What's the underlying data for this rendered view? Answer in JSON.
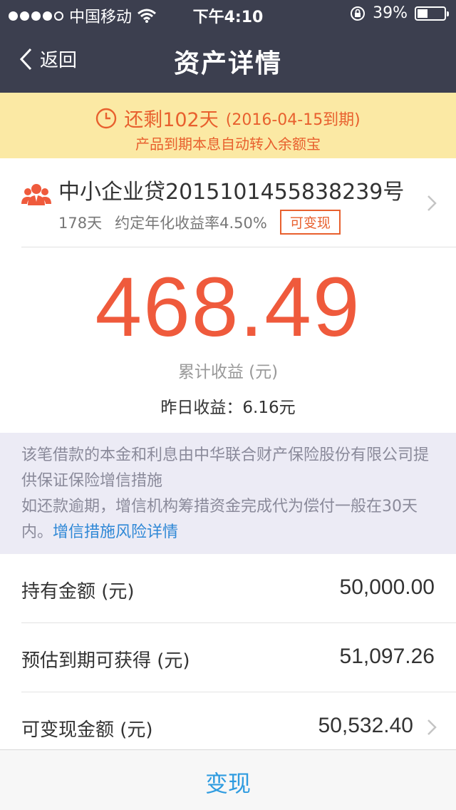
{
  "status_bar": {
    "carrier": "中国移动",
    "time": "下午4:10",
    "battery": "39%"
  },
  "nav": {
    "back_label": "返回",
    "title": "资产详情"
  },
  "notice": {
    "remaining": "还剩102天",
    "due": "(2016-04-15到期)",
    "message": "产品到期本息自动转入余额宝"
  },
  "product": {
    "name": "中小企业贷2015101455838239号",
    "term": "178天",
    "rate": "约定年化收益率4.50%",
    "tag": "可变现"
  },
  "earnings": {
    "total": "468.49",
    "total_label": "累计收益 (元)",
    "yesterday": "昨日收益：6.16元"
  },
  "guarantee": {
    "text1": "该笔借款的本金和利息由中华联合财产保险股份有限公司提供保证保险增信措施",
    "text2": "如还款逾期，增信机构筹措资金完成代为偿付一般在30天内。",
    "link": "增信措施风险详情"
  },
  "details": [
    {
      "label": "持有金额 (元)",
      "value": "50,000.00"
    },
    {
      "label": "预估到期可获得 (元)",
      "value": "51,097.26"
    },
    {
      "label": "可变现金额 (元)",
      "value": "50,532.40"
    }
  ],
  "action": {
    "cashout_label": "变现"
  },
  "colors": {
    "nav_bg": "#3c3f4f",
    "accent_orange": "#ef5a3c",
    "notice_bg": "#fbe9a4",
    "link_blue": "#2f88d6"
  }
}
